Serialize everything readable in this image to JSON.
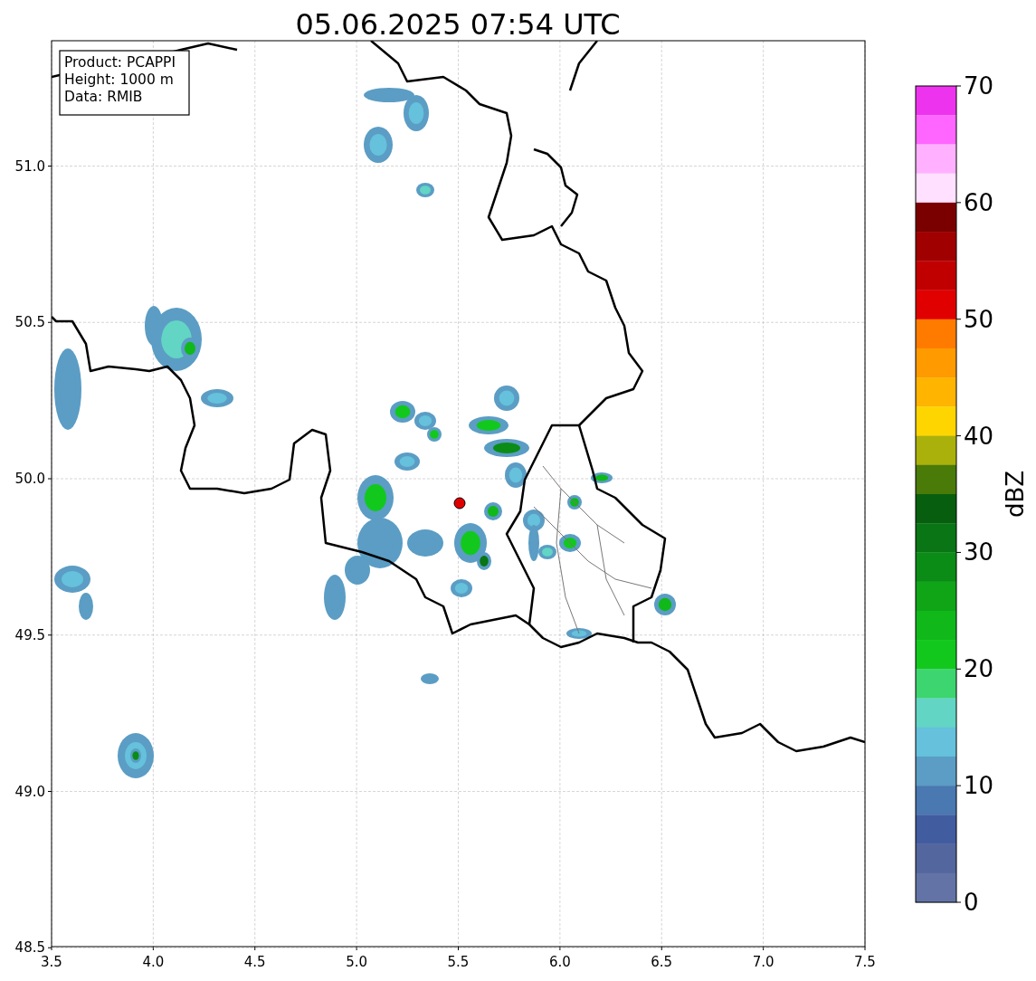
{
  "title": "05.06.2025 07:54 UTC",
  "info_box": [
    "Product: PCAPPI",
    "Height: 1000 m",
    "Data: RMIB"
  ],
  "map": {
    "x_tick_labels": [
      "3.5",
      "4.0",
      "4.5",
      "5.0",
      "5.5",
      "6.0",
      "6.5",
      "7.0",
      "7.5"
    ],
    "y_tick_labels": [
      "51.0",
      "50.5",
      "50.0",
      "49.5",
      "49.0",
      "48.5"
    ]
  },
  "colorbar": {
    "label": "dBZ",
    "tick_labels": [
      "70",
      "60",
      "50",
      "40",
      "30",
      "20",
      "10",
      "0"
    ],
    "bands": [
      {
        "color": "#ee33ee"
      },
      {
        "color": "#ff66ff"
      },
      {
        "color": "#ffb0ff"
      },
      {
        "color": "#ffe0ff"
      },
      {
        "color": "#7a0000"
      },
      {
        "color": "#a00000"
      },
      {
        "color": "#c00000"
      },
      {
        "color": "#e00000"
      },
      {
        "color": "#ff7b00"
      },
      {
        "color": "#ff9a00"
      },
      {
        "color": "#ffb400"
      },
      {
        "color": "#ffd500"
      },
      {
        "color": "#aab10a"
      },
      {
        "color": "#4a7a08"
      },
      {
        "color": "#075e0f"
      },
      {
        "color": "#097514"
      },
      {
        "color": "#0b8c16"
      },
      {
        "color": "#0fa517"
      },
      {
        "color": "#10b81a"
      },
      {
        "color": "#12c81d"
      },
      {
        "color": "#3dd56f"
      },
      {
        "color": "#62d5c4"
      },
      {
        "color": "#65c1dc"
      },
      {
        "color": "#5b9dc4"
      },
      {
        "color": "#4a78b0"
      },
      {
        "color": "#425ca0"
      },
      {
        "color": "#54669e"
      },
      {
        "color": "#6373a6"
      }
    ]
  }
}
